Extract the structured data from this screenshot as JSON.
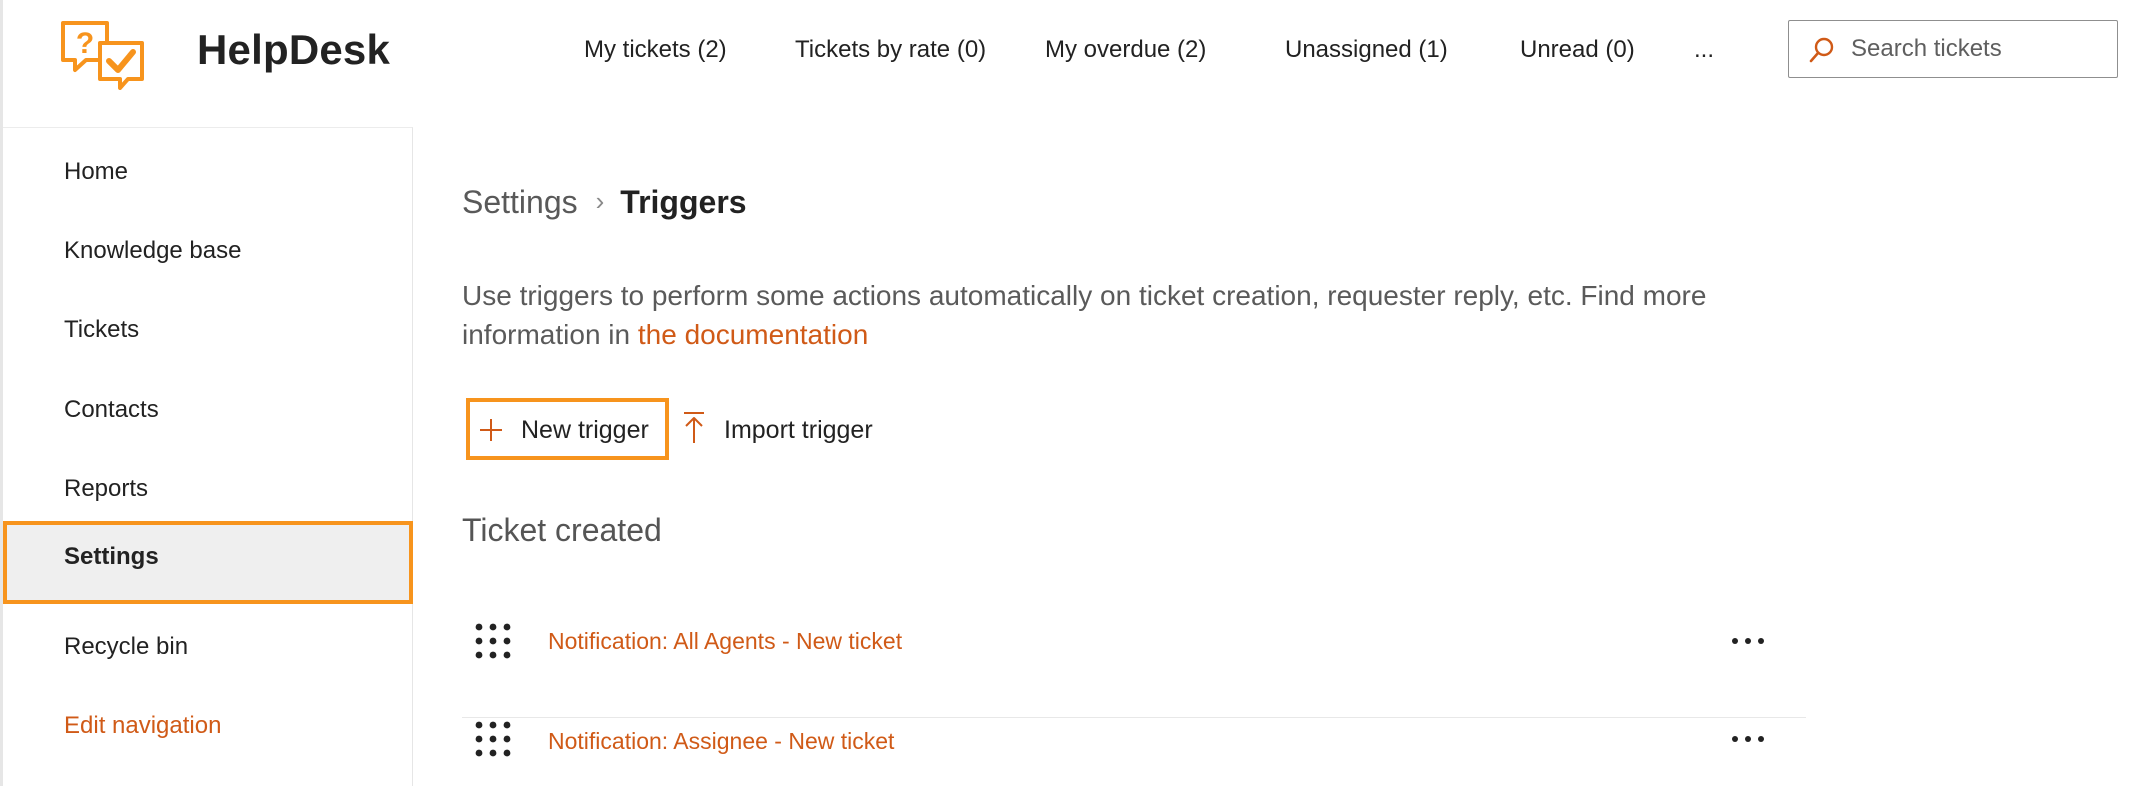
{
  "app": {
    "title": "HelpDesk"
  },
  "topnav": {
    "items": [
      {
        "label": "My tickets (2)"
      },
      {
        "label": "Tickets by rate (0)"
      },
      {
        "label": "My overdue (2)"
      },
      {
        "label": "Unassigned (1)"
      },
      {
        "label": "Unread (0)"
      }
    ],
    "more_label": "...",
    "search_placeholder": "Search tickets"
  },
  "sidebar": {
    "items": [
      {
        "label": "Home"
      },
      {
        "label": "Knowledge base"
      },
      {
        "label": "Tickets"
      },
      {
        "label": "Contacts"
      },
      {
        "label": "Reports"
      },
      {
        "label": "Settings",
        "active": true
      },
      {
        "label": "Recycle bin"
      },
      {
        "label": "Edit navigation"
      }
    ]
  },
  "breadcrumb": {
    "root": "Settings",
    "separator": "›",
    "current": "Triggers"
  },
  "description": {
    "text": "Use triggers to perform some actions automatically on ticket creation, requester reply, etc. Find more information in ",
    "link": "the documentation"
  },
  "actions": {
    "new_trigger": "New trigger",
    "import_trigger": "Import trigger"
  },
  "section": {
    "title": "Ticket created"
  },
  "triggers": [
    {
      "name": "Notification: All Agents - New ticket"
    },
    {
      "name": "Notification: Assignee - New ticket"
    }
  ],
  "colors": {
    "accent": "#d05a17",
    "highlight": "#f7941d",
    "active_bg": "#efefef",
    "text": "#222222"
  }
}
